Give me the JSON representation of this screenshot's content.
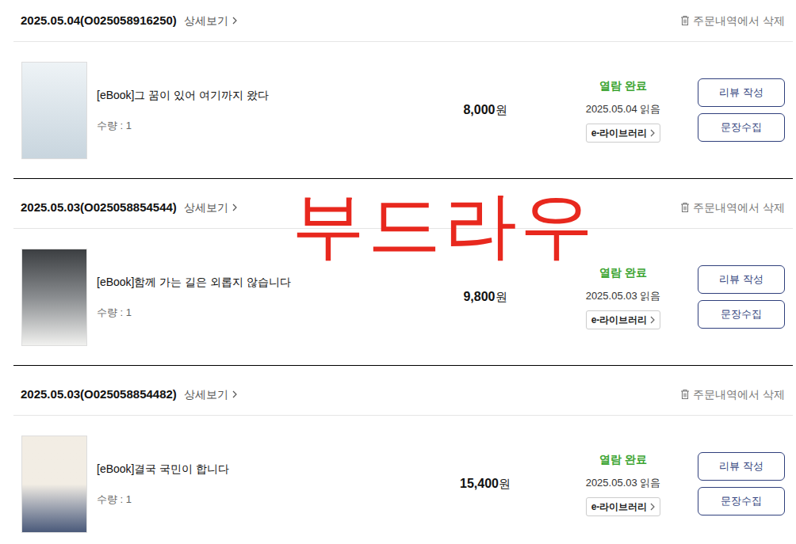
{
  "orders": [
    {
      "order": "2025.05.04(O025058916250)",
      "detail": "상세보기",
      "delete": "주문내역에서 삭제",
      "item": {
        "title": "[eBook]그 꿈이 있어 여기까지 왔다",
        "qty": "수량 : 1",
        "price": "8,000",
        "currency": "원",
        "status": "열람 완료",
        "read_date": "2025.05.04 읽음",
        "library": "e-라이브러리",
        "buttons": [
          "리뷰 작성",
          "문장수집"
        ]
      }
    },
    {
      "order": "2025.05.03(O025058854544)",
      "detail": "상세보기",
      "delete": "주문내역에서 삭제",
      "item": {
        "title": "[eBook]함께 가는 길은 외롭지 않습니다",
        "qty": "수량 : 1",
        "price": "9,800",
        "currency": "원",
        "status": "열람 완료",
        "read_date": "2025.05.03 읽음",
        "library": "e-라이브러리",
        "buttons": [
          "리뷰 작성",
          "문장수집"
        ]
      }
    },
    {
      "order": "2025.05.03(O025058854482)",
      "detail": "상세보기",
      "delete": "주문내역에서 삭제",
      "item": {
        "title": "[eBook]결국 국민이 합니다",
        "qty": "수량 : 1",
        "price": "15,400",
        "currency": "원",
        "status": "열람 완료",
        "read_date": "2025.05.03 읽음",
        "library": "e-라이브러리",
        "buttons": [
          "리뷰 작성",
          "문장수집"
        ]
      }
    }
  ],
  "annotation": {
    "text": "부드라우",
    "color": "#e8281e"
  }
}
